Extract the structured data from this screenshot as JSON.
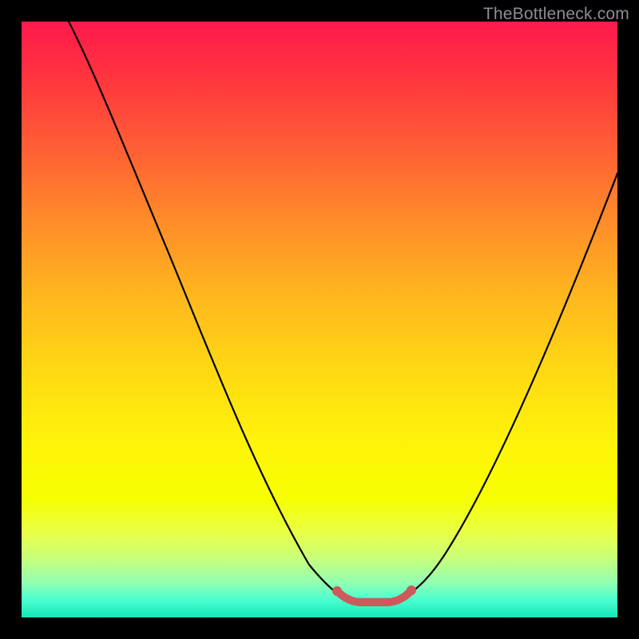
{
  "watermark": "TheBottleneck.com",
  "chart_data": {
    "type": "line",
    "title": "",
    "xlabel": "",
    "ylabel": "",
    "xlim": [
      0,
      100
    ],
    "ylim": [
      0,
      100
    ],
    "grid": false,
    "legend": "none",
    "series": [
      {
        "name": "main-curve",
        "color": "#000000",
        "x": [
          8,
          15,
          22,
          30,
          38,
          46,
          53,
          57,
          61,
          65,
          70,
          76,
          82,
          88,
          94,
          100
        ],
        "values": [
          100,
          85,
          70,
          55,
          40,
          25,
          12,
          6,
          3,
          3,
          6,
          14,
          27,
          42,
          58,
          75
        ]
      },
      {
        "name": "valley-highlight",
        "color": "#cc5a5a",
        "x": [
          53,
          57,
          61,
          65
        ],
        "values": [
          6,
          3,
          3,
          6
        ]
      }
    ]
  }
}
